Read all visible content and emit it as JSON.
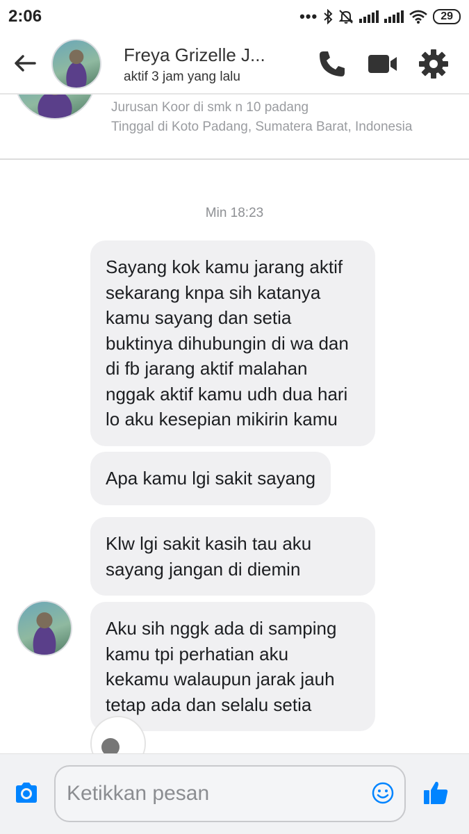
{
  "status_bar": {
    "time": "2:06",
    "battery": "29",
    "icons": [
      "dots-icon",
      "bluetooth-icon",
      "mute-icon",
      "signal-icon",
      "signal-icon",
      "wifi-icon",
      "battery-icon"
    ]
  },
  "header": {
    "contact_name": "Freya Grizelle J...",
    "status": "aktif 3 jam yang lalu",
    "icons": [
      "back-arrow-icon",
      "phone-icon",
      "video-icon",
      "gear-icon"
    ],
    "accent_color": "#333333"
  },
  "profile": {
    "lines": [
      "Jurusan Koor di smk n 10 padang",
      "Tinggal di Koto Padang, Sumatera Barat, Indonesia"
    ]
  },
  "conversation": {
    "timestamp": "Min 18:23",
    "messages": [
      {
        "lines": [
          "Sayang kok kamu jarang aktif",
          "sekarang knpa sih katanya",
          "kamu sayang dan setia",
          "buktinya dihubungin di wa dan",
          "di fb jarang aktif malahan",
          "nggak aktif kamu udh dua hari",
          "lo aku kesepian mikirin kamu"
        ]
      },
      {
        "lines": [
          "Apa kamu lgi sakit sayang"
        ]
      },
      {
        "lines": [
          "Klw lgi sakit kasih tau aku",
          "sayang jangan di diemin"
        ]
      },
      {
        "lines": [
          "Aku sih nggk ada di samping",
          "kamu tpi perhatian aku",
          "kekamu walaupun jarak jauh",
          "tetap ada dan selalu setia"
        ]
      }
    ],
    "bubble_color": "#f0f0f2"
  },
  "composer": {
    "placeholder": "Ketikkan pesan",
    "value": "",
    "icons": [
      "camera-icon",
      "emoji-icon",
      "thumbs-up-icon"
    ],
    "accent_color": "#0084ff"
  }
}
